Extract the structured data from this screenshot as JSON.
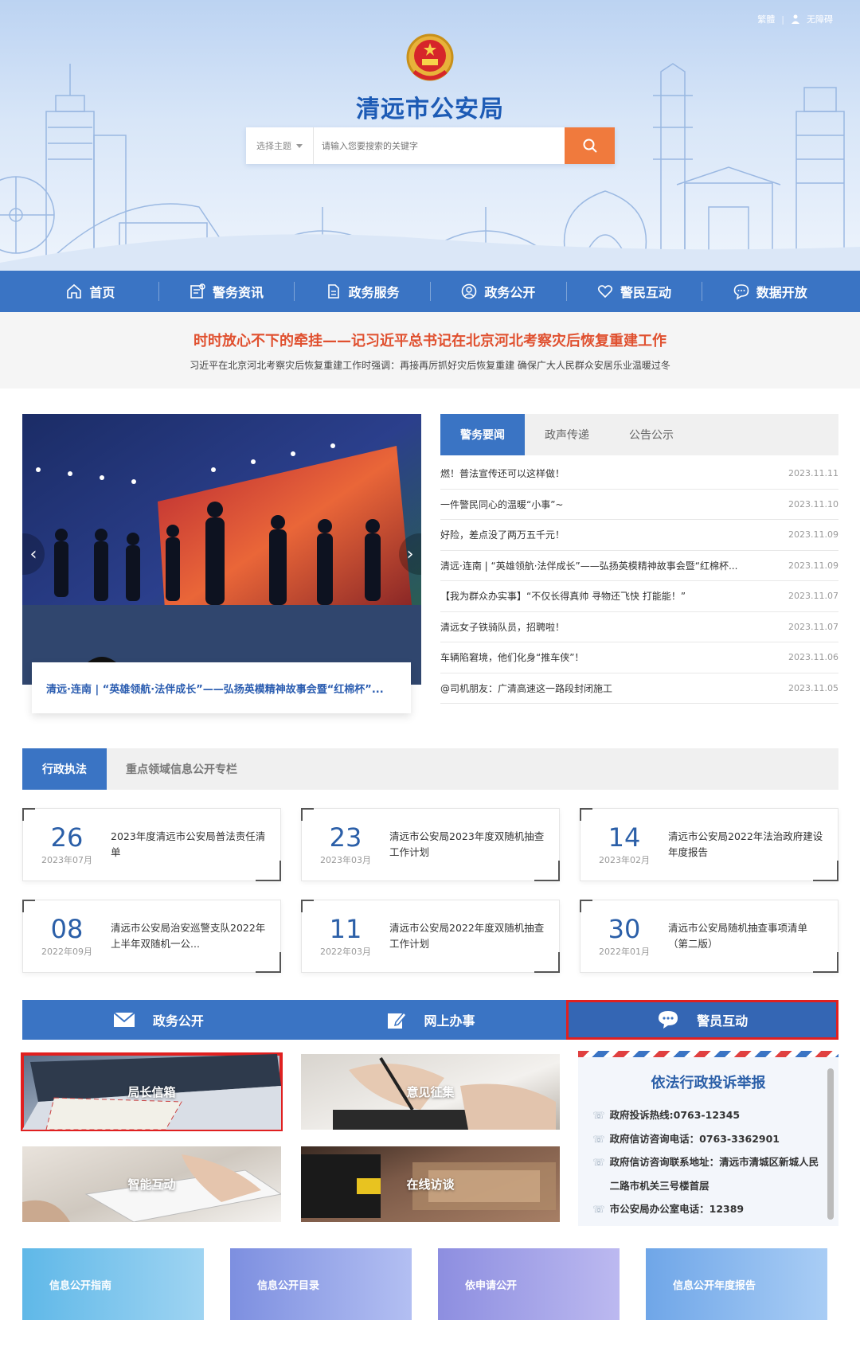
{
  "top_links": {
    "traditional": "繁體",
    "accessible": "无障碍"
  },
  "site_title": "清远市公安局",
  "search": {
    "topic": "选择主题",
    "placeholder": "请输入您要搜索的关键字"
  },
  "nav": [
    {
      "label": "首页",
      "icon": "home-icon"
    },
    {
      "label": "警务资讯",
      "icon": "news-icon"
    },
    {
      "label": "政务服务",
      "icon": "document-icon"
    },
    {
      "label": "政务公开",
      "icon": "user-circle-icon"
    },
    {
      "label": "警民互动",
      "icon": "heart-icon"
    },
    {
      "label": "数据开放",
      "icon": "chat-icon"
    }
  ],
  "headline": {
    "title": "时时放心不下的牵挂——记习近平总书记在北京河北考察灾后恢复重建工作",
    "subtitle": "习近平在北京河北考察灾后恢复重建工作时强调：再接再厉抓好灾后恢复重建 确保广大人民群众安居乐业温暖过冬"
  },
  "carousel": {
    "caption": "清远·连南 | “英雄领航·法伴成长”——弘扬英模精神故事会暨“红棉杯”..."
  },
  "news_tabs": [
    "警务要闻",
    "政声传递",
    "公告公示"
  ],
  "news": [
    {
      "title": "燃！普法宣传还可以这样做！",
      "date": "2023.11.11"
    },
    {
      "title": "一件警民同心的温暖“小事”~",
      "date": "2023.11.10"
    },
    {
      "title": "好险，差点没了两万五千元！",
      "date": "2023.11.09"
    },
    {
      "title": "清远·连南 | “英雄领航·法伴成长”——弘扬英模精神故事会暨“红棉杯...",
      "date": "2023.11.09"
    },
    {
      "title": "【我为群众办实事】“不仅长得真帅 寻物还飞快 打能能！”",
      "date": "2023.11.07"
    },
    {
      "title": "清远女子铁骑队员，招聘啦！",
      "date": "2023.11.07"
    },
    {
      "title": "车辆陷窘境，他们化身“推车侠”！",
      "date": "2023.11.06"
    },
    {
      "title": "@司机朋友：广清高速这一路段封闭施工",
      "date": "2023.11.05"
    }
  ],
  "admin_tabs": [
    "行政执法",
    "重点领域信息公开专栏"
  ],
  "admin_cards": [
    {
      "day": "26",
      "ym": "2023年07月",
      "title": "2023年度清远市公安局普法责任清单"
    },
    {
      "day": "23",
      "ym": "2023年03月",
      "title": "清远市公安局2023年度双随机抽查工作计划"
    },
    {
      "day": "14",
      "ym": "2023年02月",
      "title": "清远市公安局2022年法治政府建设年度报告"
    },
    {
      "day": "08",
      "ym": "2022年09月",
      "title": "清远市公安局治安巡警支队2022年上半年双随机一公..."
    },
    {
      "day": "11",
      "ym": "2022年03月",
      "title": "清远市公安局2022年度双随机抽查工作计划"
    },
    {
      "day": "30",
      "ym": "2022年01月",
      "title": "清远市公安局随机抽查事项清单（第二版）"
    }
  ],
  "services": [
    {
      "label": "政务公开",
      "icon": "envelope-icon"
    },
    {
      "label": "网上办事",
      "icon": "edit-icon"
    },
    {
      "label": "警员互动",
      "icon": "speech-bubble-icon"
    }
  ],
  "tiles": [
    "局长信箱",
    "意见征集",
    "智能互动",
    "在线访谈"
  ],
  "complaint": {
    "title": "依法行政投诉举报",
    "lines": [
      "政府投诉热线:0763-12345",
      "政府信访咨询电话：0763-3362901",
      "政府信访咨询联系地址：清远市清城区新城人民二路市机关三号楼首层",
      "市公安局办公室电话：12389"
    ]
  },
  "bottom_links": [
    "信息公开指南",
    "信息公开目录",
    "依申请公开",
    "信息公开年度报告"
  ],
  "colors": {
    "primary": "#3a74c4",
    "accent": "#f07a3d",
    "headline": "#e0502f",
    "highlight": "#e02020"
  }
}
